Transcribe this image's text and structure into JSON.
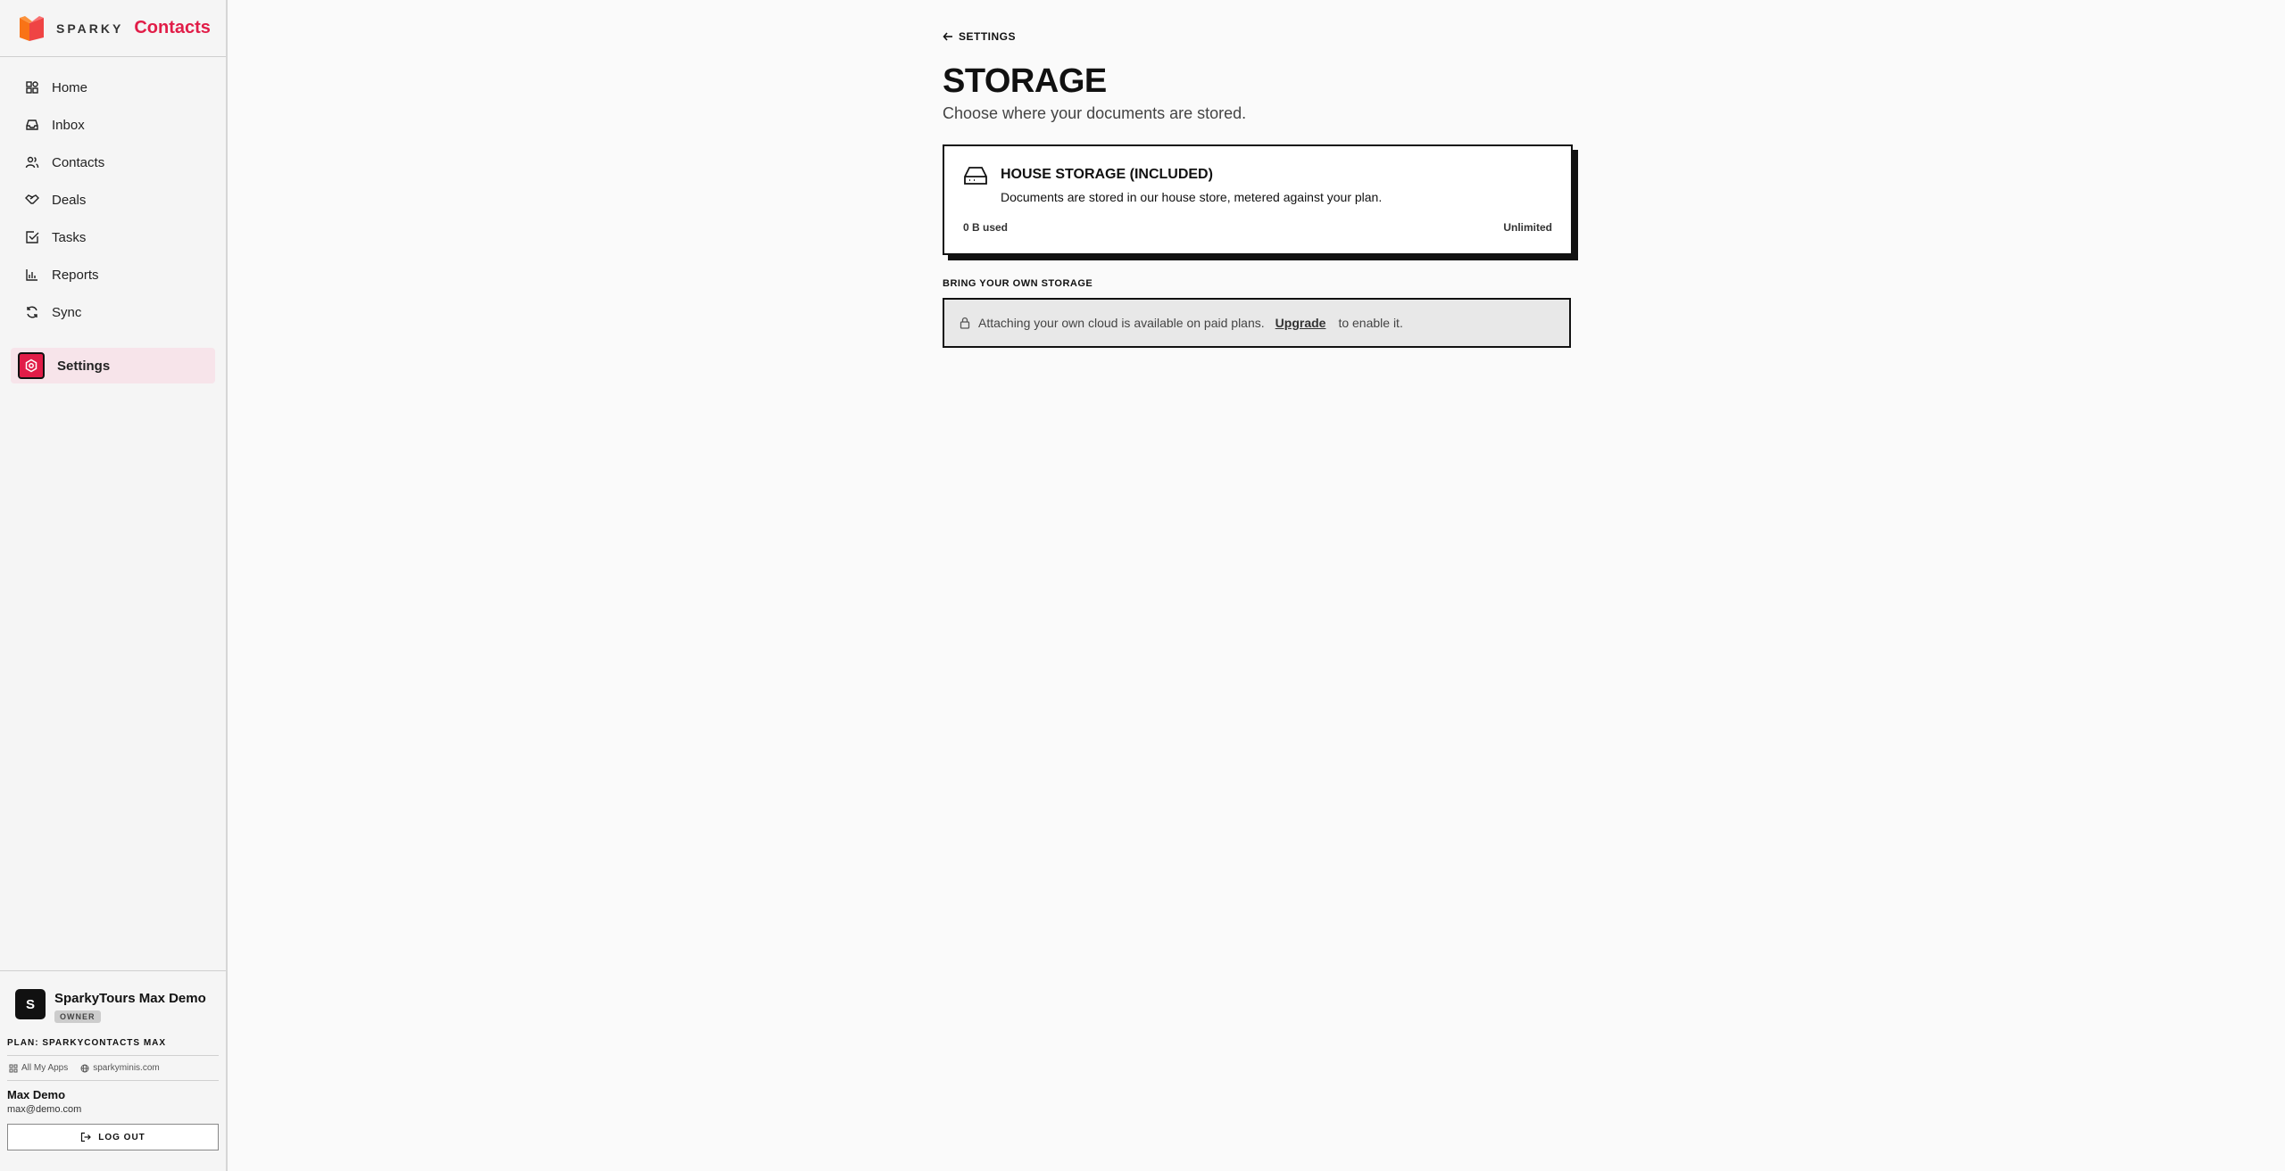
{
  "brand": {
    "sparky": "SPARKY",
    "app": "Contacts"
  },
  "nav": [
    {
      "label": "Home",
      "icon": "home-icon"
    },
    {
      "label": "Inbox",
      "icon": "inbox-icon"
    },
    {
      "label": "Contacts",
      "icon": "users-icon"
    },
    {
      "label": "Deals",
      "icon": "handshake-icon"
    },
    {
      "label": "Tasks",
      "icon": "checkbox-icon"
    },
    {
      "label": "Reports",
      "icon": "bar-chart-icon"
    },
    {
      "label": "Sync",
      "icon": "sync-icon"
    },
    {
      "label": "Settings",
      "icon": "settings-icon",
      "active": true
    }
  ],
  "org": {
    "initial": "S",
    "name": "SparkyTours Max Demo",
    "role": "OWNER"
  },
  "plan": "PLAN: SPARKYCONTACTS MAX",
  "links": {
    "all_apps": "All My Apps",
    "site": "sparkyminis.com"
  },
  "user": {
    "name": "Max Demo",
    "email": "max@demo.com"
  },
  "logout_label": "LOG OUT",
  "main": {
    "back_label": "SETTINGS",
    "title": "STORAGE",
    "subtitle": "Choose where your documents are stored.",
    "house": {
      "title": "HOUSE STORAGE (INCLUDED)",
      "desc": "Documents are stored in our house store, metered against your plan.",
      "used": "0 B used",
      "limit": "Unlimited"
    },
    "byo": {
      "label": "BRING YOUR OWN STORAGE",
      "text_before": "Attaching your own cloud is available on paid plans.",
      "upgrade": "Upgrade",
      "text_after": "to enable it."
    }
  },
  "colors": {
    "accent": "#e11d48",
    "active_bg": "#f7e4ea"
  }
}
